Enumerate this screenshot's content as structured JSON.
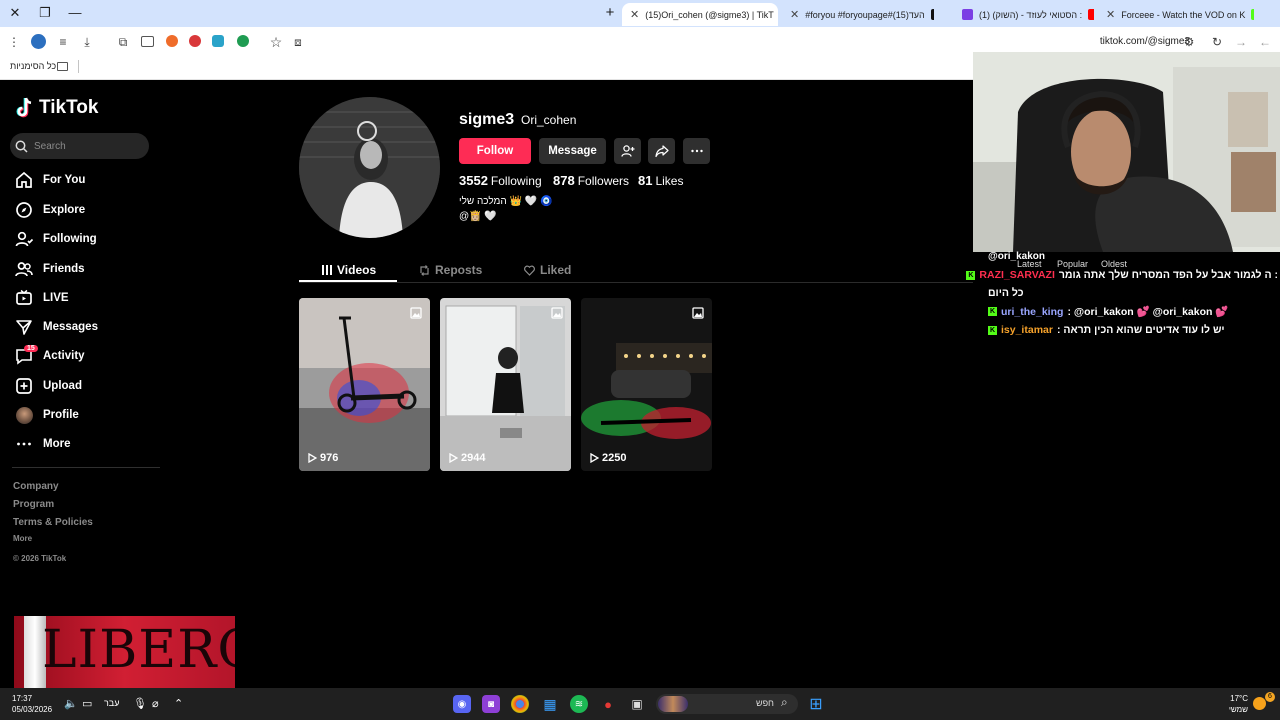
{
  "browser": {
    "tabs": [
      {
        "label": "Forceee - Watch the VOD on K",
        "favicon_color": "#53fc18",
        "active": false
      },
      {
        "label": "(1) הסטואי לעוזד - (השוק) :",
        "favicon_color": "#ff0000",
        "active": false
      },
      {
        "label": "#foryou #foryoupage#העד(15)",
        "favicon_color": "#111111",
        "active": false
      },
      {
        "label": "(15)Ori_cohen (@sigme3) | TikT",
        "favicon_color": "#111111",
        "active": true
      }
    ],
    "url": "tiktok.com/@sigme3",
    "bookmarks_label": "כל הסימניות"
  },
  "sidebar": {
    "brand": "TikTok",
    "search_placeholder": "Search",
    "nav": [
      {
        "label": "For You",
        "icon": "home-icon"
      },
      {
        "label": "Explore",
        "icon": "compass-icon"
      },
      {
        "label": "Following",
        "icon": "following-icon"
      },
      {
        "label": "Friends",
        "icon": "friends-icon"
      },
      {
        "label": "LIVE",
        "icon": "live-icon"
      },
      {
        "label": "Messages",
        "icon": "messages-icon"
      },
      {
        "label": "Activity",
        "icon": "activity-icon",
        "badge": "15"
      },
      {
        "label": "Upload",
        "icon": "upload-icon"
      },
      {
        "label": "Profile",
        "icon": "avatar"
      },
      {
        "label": "More",
        "icon": "more-icon"
      }
    ],
    "footer": {
      "company": "Company",
      "program": "Program",
      "terms": "Terms & Policies",
      "more": "More",
      "copyright": "© 2026 TikTok"
    }
  },
  "profile": {
    "username": "sigme3",
    "nickname": "Ori_cohen",
    "follow_label": "Follow",
    "message_label": "Message",
    "following_count": "3552",
    "following_label": "Following",
    "followers_count": "878",
    "followers_label": "Followers",
    "likes_count": "81",
    "likes_label": "Likes",
    "bio_line1": "המלכה שלי 👑 🤍 🧿",
    "bio_line2": "@👸🏼 🤍",
    "accent_color": "#fe2c55"
  },
  "tabs": {
    "videos": "Videos",
    "reposts": "Reposts",
    "liked": "Liked"
  },
  "videos": [
    {
      "views": "976"
    },
    {
      "views": "2944"
    },
    {
      "views": "2250"
    }
  ],
  "stream_overlay": {
    "chat_header_user": "@ori_kakon",
    "filters": {
      "latest": "Latest",
      "popular": "Popular",
      "oldest": "Oldest"
    },
    "messages": [
      {
        "user": "RAZI_SARVAZI",
        "user_color": "#ff2e4f",
        "text": "ה לגמור אבל על הפד המסריח שלך אתה גומר :",
        "text2": "כל היום"
      },
      {
        "user": "uri_the_king",
        "user_color": "#9aa6ff",
        "text": ": @ori_kakon 💕 @ori_kakon 💕"
      },
      {
        "user": "isy_itamar",
        "user_color": "#f6a22b",
        "text": ": יש לו עוד אדיטים שהוא הכין תראה"
      }
    ],
    "ad_text": "LIBERO"
  },
  "taskbar": {
    "time": "17:37",
    "date": "05/03/2026",
    "lang": "עבר",
    "search_label": "חפש",
    "weather_temp": "17°C",
    "weather_desc": "שמשי",
    "notif_count": "6"
  }
}
